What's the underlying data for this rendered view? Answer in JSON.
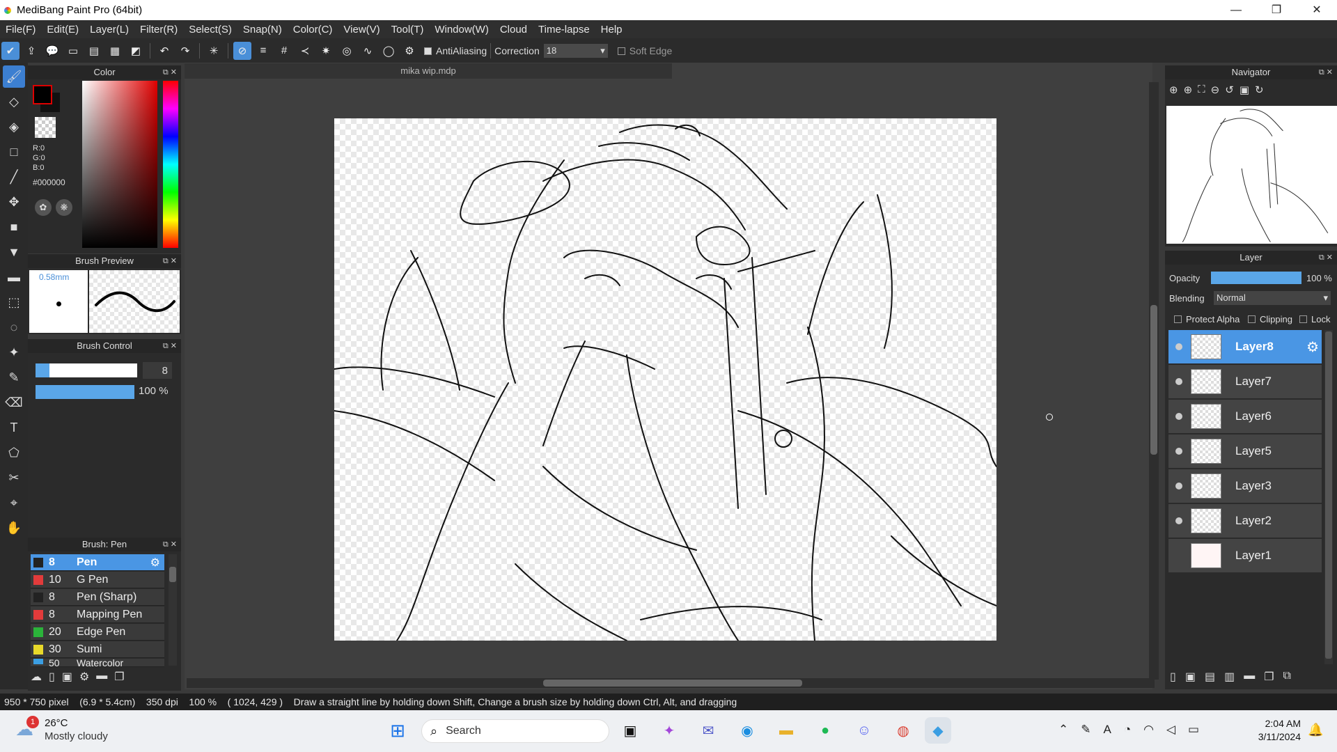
{
  "window": {
    "title": "MediBang Paint Pro (64bit)",
    "minimize": "—",
    "maximize": "❐",
    "close": "✕"
  },
  "menu": [
    "File(F)",
    "Edit(E)",
    "Layer(L)",
    "Filter(R)",
    "Select(S)",
    "Snap(N)",
    "Color(C)",
    "View(V)",
    "Tool(T)",
    "Window(W)",
    "Cloud",
    "Time-lapse",
    "Help"
  ],
  "toolbar": {
    "antialiasing_label": "AntiAliasing",
    "correction_label": "Correction",
    "correction_value": "18",
    "soft_edge_label": "Soft Edge"
  },
  "color_panel": {
    "title": "Color",
    "r": "R:0",
    "g": "G:0",
    "b": "B:0",
    "hex": "#000000",
    "foreground": "#000000"
  },
  "brush_preview": {
    "title": "Brush Preview",
    "size_label": "0.58mm"
  },
  "brush_control": {
    "title": "Brush Control",
    "size": "8",
    "opacity": "100 %"
  },
  "brush_list": {
    "title": "Brush: Pen",
    "items": [
      {
        "size": "8",
        "name": "Pen",
        "color": "#222222",
        "selected": true
      },
      {
        "size": "10",
        "name": "G Pen",
        "color": "#e23b3b"
      },
      {
        "size": "8",
        "name": "Pen (Sharp)",
        "color": "#222222"
      },
      {
        "size": "8",
        "name": "Mapping Pen",
        "color": "#e23b3b"
      },
      {
        "size": "20",
        "name": "Edge Pen",
        "color": "#2bb33a"
      },
      {
        "size": "30",
        "name": "Sumi",
        "color": "#e8d92a"
      },
      {
        "size": "50",
        "name": "Watercolor",
        "color": "#3b9ee2"
      }
    ]
  },
  "document": {
    "tab": "mika wip.mdp"
  },
  "navigator": {
    "title": "Navigator"
  },
  "layer_panel": {
    "title": "Layer",
    "opacity_label": "Opacity",
    "opacity_value": "100 %",
    "blending_label": "Blending",
    "blending_value": "Normal",
    "protect_alpha": "Protect Alpha",
    "clipping": "Clipping",
    "lock": "Lock",
    "layers": [
      {
        "name": "Layer8",
        "visible": true,
        "selected": true
      },
      {
        "name": "Layer7",
        "visible": true
      },
      {
        "name": "Layer6",
        "visible": true
      },
      {
        "name": "Layer5",
        "visible": true
      },
      {
        "name": "Layer3",
        "visible": true
      },
      {
        "name": "Layer2",
        "visible": true
      },
      {
        "name": "Layer1",
        "visible": false
      }
    ]
  },
  "status": {
    "pixels": "950 * 750 pixel",
    "cm": "(6.9 * 5.4cm)",
    "dpi": "350 dpi",
    "zoom": "100 %",
    "coords": "( 1024, 429 )",
    "hint": "Draw a straight line by holding down Shift, Change a brush size by holding down Ctrl, Alt, and dragging"
  },
  "taskbar": {
    "weather_temp": "26°C",
    "weather_desc": "Mostly cloudy",
    "weather_badge": "1",
    "search_label": "Search",
    "time": "2:04 AM",
    "date": "3/11/2024"
  }
}
